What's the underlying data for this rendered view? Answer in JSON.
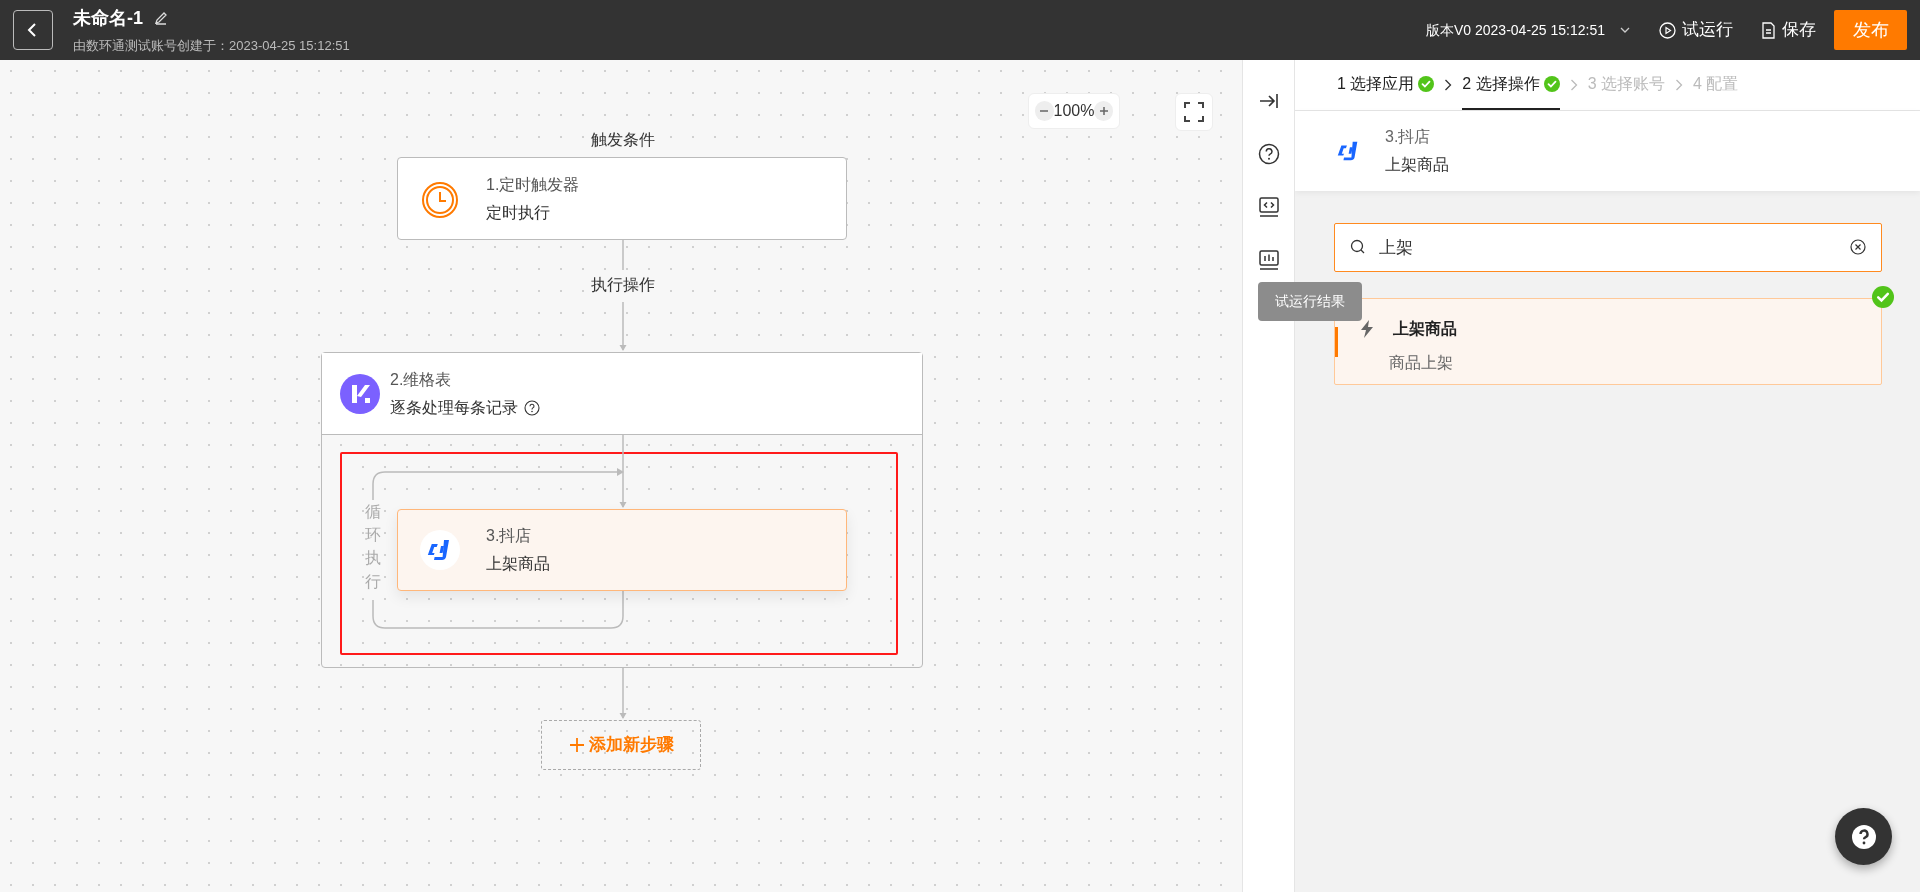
{
  "header": {
    "title": "未命名-1",
    "subtitle": "由数环通测试账号创建于：2023-04-25 15:12:51",
    "version": "版本V0 2023-04-25 15:12:51",
    "actions": [
      {
        "kind": "run",
        "label": "试运行"
      },
      {
        "kind": "save",
        "label": "保存"
      }
    ],
    "publish": "发布"
  },
  "canvas": {
    "zoom": "100%",
    "trigger_label": "触发条件",
    "action_label": "执行操作",
    "loop_label": "循环执行",
    "add_step": "添加新步骤",
    "trigger": {
      "title": "1.定时触发器",
      "subtitle": "定时执行"
    },
    "loop_node": {
      "title": "2.维格表",
      "subtitle": "逐条处理每条记录"
    },
    "inner_node": {
      "title": "3.抖店",
      "subtitle": "上架商品",
      "selected": true
    }
  },
  "sidebar_tooltip": "试运行结果",
  "panel": {
    "steps": [
      {
        "label": "1 选择应用",
        "done": true,
        "selected": false,
        "available": true
      },
      {
        "label": "2 选择操作",
        "done": true,
        "selected": true,
        "available": true
      },
      {
        "label": "3 选择账号",
        "done": false,
        "selected": false,
        "available": false
      },
      {
        "label": "4 配置",
        "done": false,
        "selected": false,
        "available": false
      }
    ],
    "app": {
      "title": "3.抖店",
      "subtitle": "上架商品"
    },
    "search": {
      "value": "上架"
    },
    "results": [
      {
        "title": "上架商品",
        "description": "商品上架",
        "selected": true
      }
    ]
  }
}
